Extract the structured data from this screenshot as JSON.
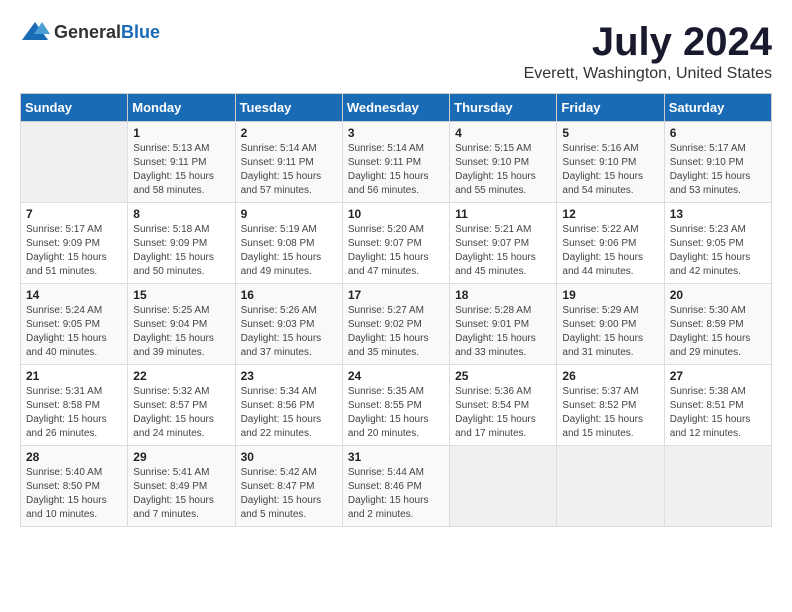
{
  "logo": {
    "general": "General",
    "blue": "Blue"
  },
  "title": "July 2024",
  "location": "Everett, Washington, United States",
  "headers": [
    "Sunday",
    "Monday",
    "Tuesday",
    "Wednesday",
    "Thursday",
    "Friday",
    "Saturday"
  ],
  "weeks": [
    [
      {
        "day": "",
        "info": ""
      },
      {
        "day": "1",
        "info": "Sunrise: 5:13 AM\nSunset: 9:11 PM\nDaylight: 15 hours\nand 58 minutes."
      },
      {
        "day": "2",
        "info": "Sunrise: 5:14 AM\nSunset: 9:11 PM\nDaylight: 15 hours\nand 57 minutes."
      },
      {
        "day": "3",
        "info": "Sunrise: 5:14 AM\nSunset: 9:11 PM\nDaylight: 15 hours\nand 56 minutes."
      },
      {
        "day": "4",
        "info": "Sunrise: 5:15 AM\nSunset: 9:10 PM\nDaylight: 15 hours\nand 55 minutes."
      },
      {
        "day": "5",
        "info": "Sunrise: 5:16 AM\nSunset: 9:10 PM\nDaylight: 15 hours\nand 54 minutes."
      },
      {
        "day": "6",
        "info": "Sunrise: 5:17 AM\nSunset: 9:10 PM\nDaylight: 15 hours\nand 53 minutes."
      }
    ],
    [
      {
        "day": "7",
        "info": "Sunrise: 5:17 AM\nSunset: 9:09 PM\nDaylight: 15 hours\nand 51 minutes."
      },
      {
        "day": "8",
        "info": "Sunrise: 5:18 AM\nSunset: 9:09 PM\nDaylight: 15 hours\nand 50 minutes."
      },
      {
        "day": "9",
        "info": "Sunrise: 5:19 AM\nSunset: 9:08 PM\nDaylight: 15 hours\nand 49 minutes."
      },
      {
        "day": "10",
        "info": "Sunrise: 5:20 AM\nSunset: 9:07 PM\nDaylight: 15 hours\nand 47 minutes."
      },
      {
        "day": "11",
        "info": "Sunrise: 5:21 AM\nSunset: 9:07 PM\nDaylight: 15 hours\nand 45 minutes."
      },
      {
        "day": "12",
        "info": "Sunrise: 5:22 AM\nSunset: 9:06 PM\nDaylight: 15 hours\nand 44 minutes."
      },
      {
        "day": "13",
        "info": "Sunrise: 5:23 AM\nSunset: 9:05 PM\nDaylight: 15 hours\nand 42 minutes."
      }
    ],
    [
      {
        "day": "14",
        "info": "Sunrise: 5:24 AM\nSunset: 9:05 PM\nDaylight: 15 hours\nand 40 minutes."
      },
      {
        "day": "15",
        "info": "Sunrise: 5:25 AM\nSunset: 9:04 PM\nDaylight: 15 hours\nand 39 minutes."
      },
      {
        "day": "16",
        "info": "Sunrise: 5:26 AM\nSunset: 9:03 PM\nDaylight: 15 hours\nand 37 minutes."
      },
      {
        "day": "17",
        "info": "Sunrise: 5:27 AM\nSunset: 9:02 PM\nDaylight: 15 hours\nand 35 minutes."
      },
      {
        "day": "18",
        "info": "Sunrise: 5:28 AM\nSunset: 9:01 PM\nDaylight: 15 hours\nand 33 minutes."
      },
      {
        "day": "19",
        "info": "Sunrise: 5:29 AM\nSunset: 9:00 PM\nDaylight: 15 hours\nand 31 minutes."
      },
      {
        "day": "20",
        "info": "Sunrise: 5:30 AM\nSunset: 8:59 PM\nDaylight: 15 hours\nand 29 minutes."
      }
    ],
    [
      {
        "day": "21",
        "info": "Sunrise: 5:31 AM\nSunset: 8:58 PM\nDaylight: 15 hours\nand 26 minutes."
      },
      {
        "day": "22",
        "info": "Sunrise: 5:32 AM\nSunset: 8:57 PM\nDaylight: 15 hours\nand 24 minutes."
      },
      {
        "day": "23",
        "info": "Sunrise: 5:34 AM\nSunset: 8:56 PM\nDaylight: 15 hours\nand 22 minutes."
      },
      {
        "day": "24",
        "info": "Sunrise: 5:35 AM\nSunset: 8:55 PM\nDaylight: 15 hours\nand 20 minutes."
      },
      {
        "day": "25",
        "info": "Sunrise: 5:36 AM\nSunset: 8:54 PM\nDaylight: 15 hours\nand 17 minutes."
      },
      {
        "day": "26",
        "info": "Sunrise: 5:37 AM\nSunset: 8:52 PM\nDaylight: 15 hours\nand 15 minutes."
      },
      {
        "day": "27",
        "info": "Sunrise: 5:38 AM\nSunset: 8:51 PM\nDaylight: 15 hours\nand 12 minutes."
      }
    ],
    [
      {
        "day": "28",
        "info": "Sunrise: 5:40 AM\nSunset: 8:50 PM\nDaylight: 15 hours\nand 10 minutes."
      },
      {
        "day": "29",
        "info": "Sunrise: 5:41 AM\nSunset: 8:49 PM\nDaylight: 15 hours\nand 7 minutes."
      },
      {
        "day": "30",
        "info": "Sunrise: 5:42 AM\nSunset: 8:47 PM\nDaylight: 15 hours\nand 5 minutes."
      },
      {
        "day": "31",
        "info": "Sunrise: 5:44 AM\nSunset: 8:46 PM\nDaylight: 15 hours\nand 2 minutes."
      },
      {
        "day": "",
        "info": ""
      },
      {
        "day": "",
        "info": ""
      },
      {
        "day": "",
        "info": ""
      }
    ]
  ]
}
